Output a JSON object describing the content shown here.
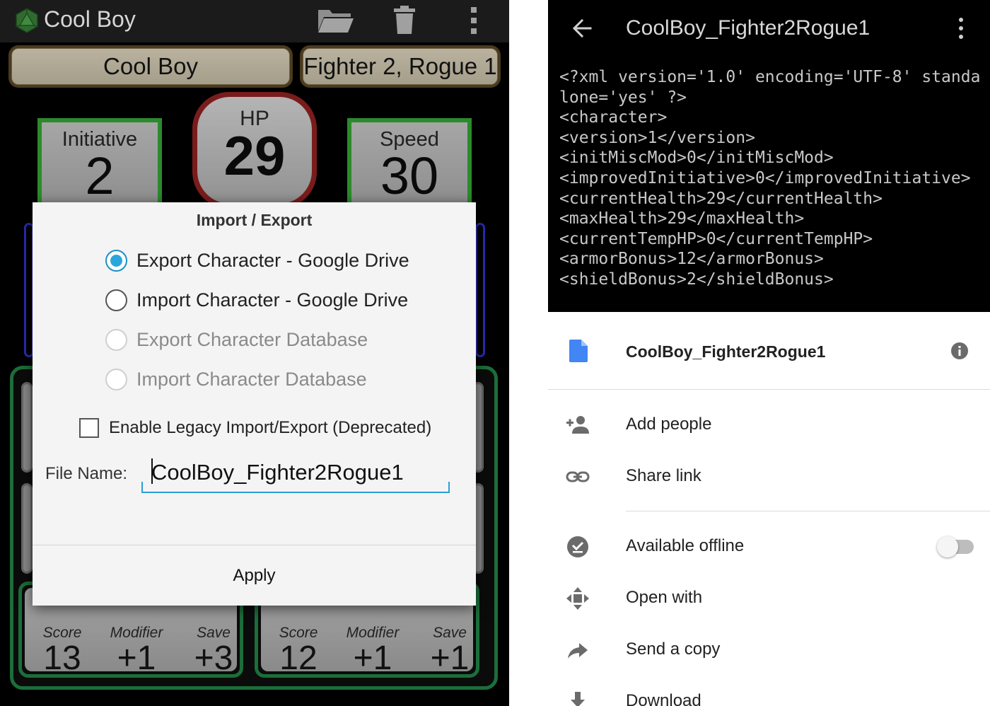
{
  "left": {
    "app": {
      "title": "Cool Boy"
    },
    "character": {
      "name": "Cool Boy",
      "classes": "Fighter 2, Rogue 1"
    },
    "stats": {
      "initiative": {
        "label": "Initiative",
        "value": "2"
      },
      "hp": {
        "label": "HP",
        "value": "29"
      },
      "speed": {
        "label": "Speed",
        "value": "30"
      }
    },
    "abilities": [
      {
        "score_label": "Score",
        "modifier_label": "Modifier",
        "save_label": "Save",
        "score": "13",
        "modifier": "+1",
        "save": "+3"
      },
      {
        "score_label": "Score",
        "modifier_label": "Modifier",
        "save_label": "Save",
        "score": "12",
        "modifier": "+1",
        "save": "+1"
      }
    ],
    "dialog": {
      "title": "Import / Export",
      "options": [
        {
          "label": "Export Character - Google Drive",
          "checked": true,
          "enabled": true
        },
        {
          "label": "Import Character - Google Drive",
          "checked": false,
          "enabled": true
        },
        {
          "label": "Export Character Database",
          "checked": false,
          "enabled": false
        },
        {
          "label": "Import Character Database",
          "checked": false,
          "enabled": false
        }
      ],
      "legacy_label": "Enable Legacy Import/Export (Deprecated)",
      "file_name_label": "File Name:",
      "file_name_value": "CoolBoy_Fighter2Rogue1",
      "apply_label": "Apply"
    }
  },
  "right": {
    "preview_title": "CoolBoy_Fighter2Rogue1",
    "xml_text": "<?xml version='1.0' encoding='UTF-8' standalone='yes' ?>\n<character>\n<version>1</version>\n<initMiscMod>0</initMiscMod>\n<improvedInitiative>0</improvedInitiative>\n<currentHealth>29</currentHealth>\n<maxHealth>29</maxHealth>\n<currentTempHP>0</currentTempHP>\n<armorBonus>12</armorBonus>\n<shieldBonus>2</shieldBonus>",
    "file_name": "CoolBoy_Fighter2Rogue1",
    "menu": [
      {
        "label": "Add people",
        "icon": "add-person-icon"
      },
      {
        "label": "Share link",
        "icon": "link-icon"
      },
      {
        "label": "Available offline",
        "icon": "offline-check-icon"
      },
      {
        "label": "Open with",
        "icon": "open-with-icon"
      },
      {
        "label": "Send a copy",
        "icon": "share-arrow-icon"
      },
      {
        "label": "Download",
        "icon": "download-icon"
      }
    ],
    "colors": {
      "doc_blue": "#4285f4",
      "accent": "#2a9fd6"
    }
  }
}
